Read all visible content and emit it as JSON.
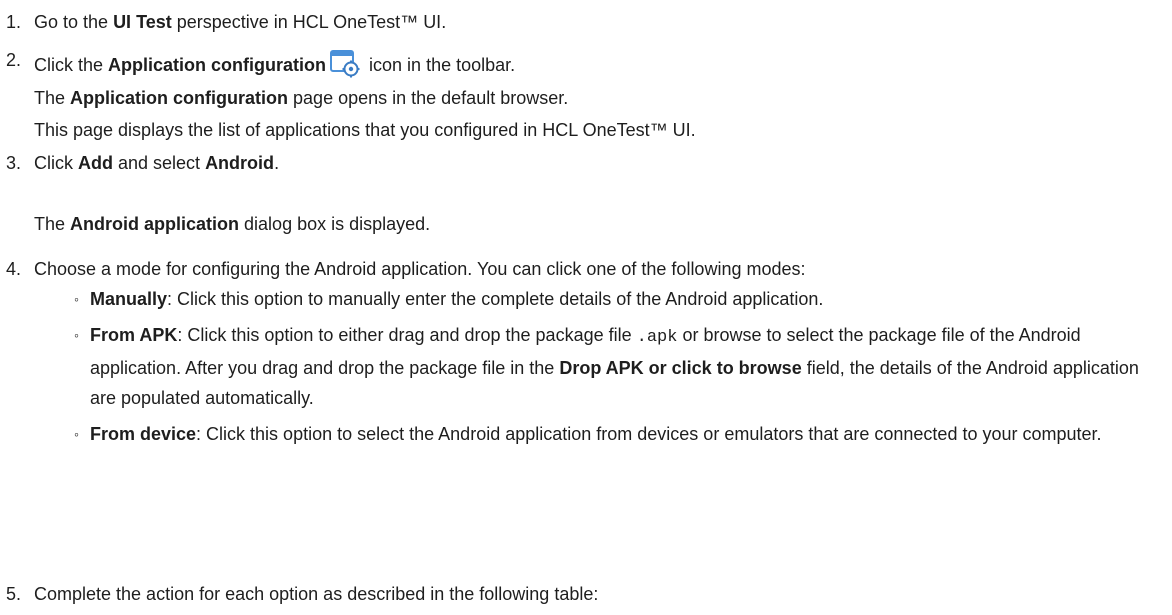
{
  "steps": [
    {
      "num": "1.",
      "pre": "Go to the ",
      "bold": "UI Test",
      "post": " perspective in HCL OneTest™ UI."
    },
    {
      "num": "2.",
      "pre": "Click the ",
      "bold": "Application configuration",
      "post": " icon in the toolbar.",
      "icon": "application-configuration-icon",
      "sub1_bold": "Application configuration",
      "sub1_post": " page opens in the default browser.",
      "sub1_pre": "The ",
      "sub2": "This page displays the list of applications that you configured in HCL OneTest™ UI."
    },
    {
      "num": "3.",
      "pre": "Click ",
      "bold1": "Add",
      "mid": " and select ",
      "bold2": "Android",
      "post": ".",
      "sub_pre": "The ",
      "sub_bold": "Android application",
      "sub_post": " dialog box is displayed."
    },
    {
      "num": "4.",
      "text": "Choose a mode for configuring the Android application. You can click one of the following modes:",
      "bullets": [
        {
          "bold": "Manually",
          "text": ": Click this option to manually enter the complete details of the Android application."
        },
        {
          "bold": "From APK",
          "text_a": ": Click this option to either drag and drop the package file ",
          "code": ".apk",
          "text_b": " or browse to select the package file of the Android application. After you drag and drop the package file in the ",
          "bold2": "Drop APK or click to browse",
          "text_c": " field, the details of the Android application are populated automatically."
        },
        {
          "bold": "From device",
          "text": ": Click this option to select the Android application from devices or emulators that are connected to your computer."
        }
      ]
    },
    {
      "num": "5.",
      "text": "Complete the action for each option as described in the following table:"
    }
  ],
  "colors": {
    "text": "#1e1e1e",
    "icon_blue": "#4a90d9",
    "icon_gear": "#3a7cc4"
  }
}
